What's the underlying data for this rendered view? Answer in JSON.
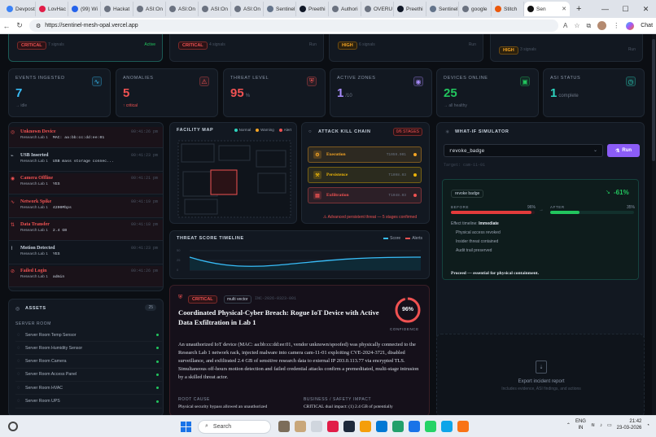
{
  "browser": {
    "tabs": [
      {
        "label": "Devpost",
        "color": "#3b82f6"
      },
      {
        "label": "LovHac",
        "color": "#e11d48"
      },
      {
        "label": "(99) Wi",
        "color": "#2563eb"
      },
      {
        "label": "Hackat",
        "color": "#6b7280"
      },
      {
        "label": "ASI:On",
        "color": "#6b7280"
      },
      {
        "label": "ASI:On",
        "color": "#6b7280"
      },
      {
        "label": "ASI:On",
        "color": "#6b7280"
      },
      {
        "label": "ASI:On",
        "color": "#6b7280"
      },
      {
        "label": "Sentinel",
        "color": "#64748b"
      },
      {
        "label": "Preethi",
        "color": "#111827"
      },
      {
        "label": "Authori",
        "color": "#6b7280"
      },
      {
        "label": "OVERU",
        "color": "#6b7280"
      },
      {
        "label": "Preethi",
        "color": "#111827"
      },
      {
        "label": "Sentinel",
        "color": "#64748b"
      },
      {
        "label": "google",
        "color": "#6b7280"
      },
      {
        "label": "Stitch",
        "color": "#ea580c"
      }
    ],
    "active_tab": "Sen",
    "url": "https://sentinel-mesh-opal.vercel.app",
    "chat_label": "Chat"
  },
  "top_alerts": [
    {
      "badge": "CRITICAL",
      "signals": "7 signals",
      "status": "Active"
    },
    {
      "badge": "CRITICAL",
      "signals": "4 signals",
      "status": "Run"
    },
    {
      "badge": "HIGH",
      "signals": "6 signals",
      "status": "Run"
    },
    {
      "badge": "HIGH",
      "signals": "3 signals",
      "status": "Run"
    }
  ],
  "stats": [
    {
      "label": "EVENTS INGESTED",
      "value": "7",
      "unit": "",
      "sub": "→ idle",
      "color": "#38bdf8",
      "icon": "∿"
    },
    {
      "label": "ANOMALIES",
      "value": "5",
      "unit": "",
      "sub": "↑ critical",
      "color": "#f05252",
      "icon": "⚠"
    },
    {
      "label": "THREAT LEVEL",
      "value": "95",
      "unit": "%",
      "sub": "",
      "color": "#f05252",
      "icon": "⛨"
    },
    {
      "label": "ACTIVE ZONES",
      "value": "1",
      "unit": "/10",
      "sub": "",
      "color": "#a78bfa",
      "icon": "◉"
    },
    {
      "label": "DEVICES ONLINE",
      "value": "25",
      "unit": "",
      "sub": "→ all healthy",
      "color": "#22c55e",
      "icon": "▣"
    },
    {
      "label": "ASI STATUS",
      "value": "1",
      "unit": "complete",
      "sub": "",
      "color": "#2dd4bf",
      "icon": "◷"
    }
  ],
  "events": [
    {
      "title": "Unknown Device",
      "color": "#f05252",
      "time": "00:41:26 pm",
      "loc": "Research Lab 1",
      "detail": "MAC: aa:bb:cc:dd:ee:01",
      "icon": "◎"
    },
    {
      "title": "USB Inserted",
      "color": "#cbd5e1",
      "time": "00:41:23 pm",
      "loc": "Research Lab 1",
      "detail": "USB mass storage connec...",
      "icon": "⌁"
    },
    {
      "title": "Camera Offline",
      "color": "#f05252",
      "time": "00:41:21 pm",
      "loc": "Research Lab 1",
      "detail": "YES",
      "icon": "◉"
    },
    {
      "title": "Network Spike",
      "color": "#f05252",
      "time": "00:41:19 pm",
      "loc": "Research Lab 1",
      "detail": "4200Mbps",
      "icon": "∿"
    },
    {
      "title": "Data Transfer",
      "color": "#f05252",
      "time": "00:41:18 pm",
      "loc": "Research Lab 1",
      "detail": "2.4 GB",
      "icon": "⇅"
    },
    {
      "title": "Motion Detected",
      "color": "#cbd5e1",
      "time": "00:41:23 pm",
      "loc": "Research Lab 1",
      "detail": "YES",
      "icon": "⌇"
    },
    {
      "title": "Failed Login",
      "color": "#f05252",
      "time": "00:41:26 pm",
      "loc": "Research Lab 1",
      "detail": "admin",
      "icon": "⊘"
    }
  ],
  "assets": {
    "title": "ASSETS",
    "count": "25",
    "group": "SERVER ROOM",
    "items": [
      "Server Room Temp Sensor",
      "Server Room Humidity Sensor",
      "Server Room Camera",
      "Server Room Access Panel",
      "Server Room HVAC",
      "Server Room UPS"
    ]
  },
  "facility": {
    "title": "FACILITY MAP",
    "legend": [
      {
        "label": "Normal",
        "color": "#2dd4bf"
      },
      {
        "label": "Warning",
        "color": "#f5a524"
      },
      {
        "label": "Alert",
        "color": "#f05252"
      }
    ]
  },
  "killchain": {
    "title": "ATTACK KILL CHAIN",
    "badge": "0/6 STAGES",
    "stages": [
      {
        "label": "Execution",
        "time": "T1059.001",
        "color": "#f5a524",
        "icon": "⚙"
      },
      {
        "label": "Persistence",
        "time": "T1098.03",
        "color": "#eab308",
        "icon": "⚒"
      },
      {
        "label": "Exfiltration",
        "time": "T1048.03",
        "color": "#f05252",
        "icon": "▤"
      }
    ],
    "footer": "⚠ Advanced persistent threat — 5 stages confirmed"
  },
  "timeline": {
    "title": "THREAT SCORE TIMELINE",
    "legend": [
      {
        "label": "Score",
        "color": "#38bdf8"
      },
      {
        "label": "Alerts",
        "color": "#f05252"
      }
    ],
    "ticks": [
      "0",
      "25",
      "50"
    ]
  },
  "incident": {
    "badge": "CRITICAL",
    "tag": "multi vector",
    "id": "INC-2026-0323-001",
    "title": "Coordinated Physical-Cyber Breach: Rogue IoT Device with Active Data Exfiltration in Lab 1",
    "confidence": "96%",
    "confidence_value": 0.96,
    "confidence_label": "CONFIDENCE",
    "body": "An unauthorized IoT device (MAC: aa:bb:cc:dd:ee:01, vendor unknown/spoofed) was physically connected to the Research Lab 1 network rack, injected malware into camera cam-11-01 exploiting CVE-2024-3721, disabled surveillance, and exfiltrated 2.4 GB of sensitive research data to external IP 203.0.113.77 via encrypted TLS. Simultaneous off-hours motion detection and failed credential attacks confirm a premeditated, multi-stage intrusion by a skilled threat actor.",
    "root_cause_label": "ROOT CAUSE",
    "root_cause": "Physical security bypass allowed an unauthorized",
    "impact_label": "BUSINESS / SAFETY IMPACT",
    "impact": "CRITICAL dual impact: (1) 2.4 GB of potentially"
  },
  "whatif": {
    "title": "WHAT-IF SIMULATOR",
    "select": "revoke_badge",
    "run": "Run",
    "target": "Target: cam-11-01",
    "chip": "revoke badge",
    "delta": "-61%",
    "before_label": "BEFORE",
    "before_value": "96%",
    "before_fraction": 0.96,
    "after_label": "AFTER",
    "after_value": "35%",
    "after_fraction": 0.35,
    "timeline_label": "Effect timeline:",
    "timeline_value": "Immediate",
    "effects": [
      "Physical access revoked",
      "Insider threat contained",
      "Audit trail preserved"
    ],
    "conclusion": "Proceed — essential for physical containment."
  },
  "export": {
    "label": "Export incident report",
    "sub": "Includes evidence, ASI findings, and actions"
  },
  "taskbar": {
    "search": "Search",
    "lang1": "ENG",
    "lang2": "IN",
    "time": "21:42",
    "date": "23-03-2026"
  }
}
